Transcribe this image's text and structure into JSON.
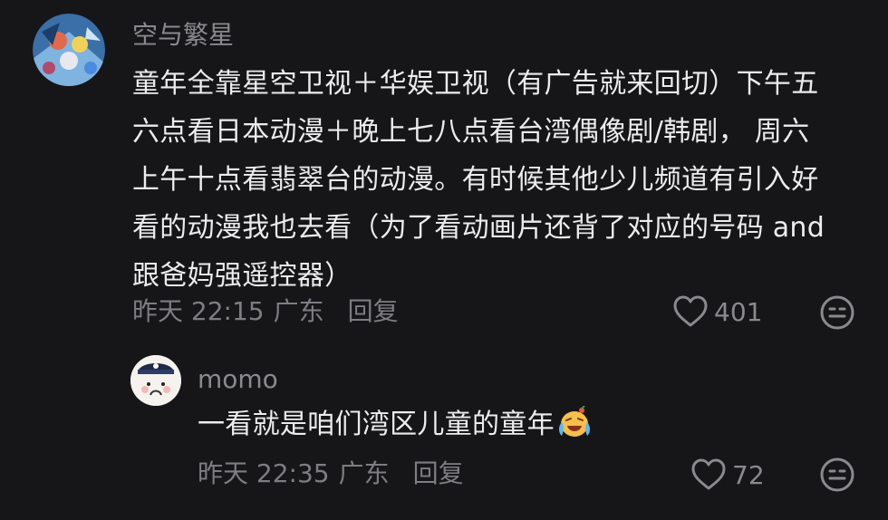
{
  "comments": [
    {
      "username": "空与繁星",
      "lines": [
        "童年全靠星空卫视＋华娱卫视（有广告就来回切）下午五",
        "六点看日本动漫＋晚上七八点看台湾偶像剧/韩剧， 周六",
        "上午十点看翡翠台的动漫。有时候其他少儿频道有引入好",
        "看的动漫我也去看（为了看动画片还背了对应的号码 and",
        "跟爸妈强遥控器）"
      ],
      "time": "昨天 22:15",
      "location": "广东",
      "reply_label": "回复",
      "likes": "401",
      "like_icon": "heart-outline-icon",
      "emoji_icon": "smiley-face-icon"
    },
    {
      "username": "momo",
      "text": "一看就是咱们湾区儿童的童年",
      "inline_emoji": "crying-laughing-emoji",
      "time": "昨天 22:35",
      "location": "广东",
      "reply_label": "回复",
      "likes": "72",
      "like_icon": "heart-outline-icon",
      "emoji_icon": "smiley-face-icon"
    }
  ],
  "colors": {
    "background": "#161618",
    "text_primary": "#ececee",
    "text_secondary": "#7d7d82"
  }
}
